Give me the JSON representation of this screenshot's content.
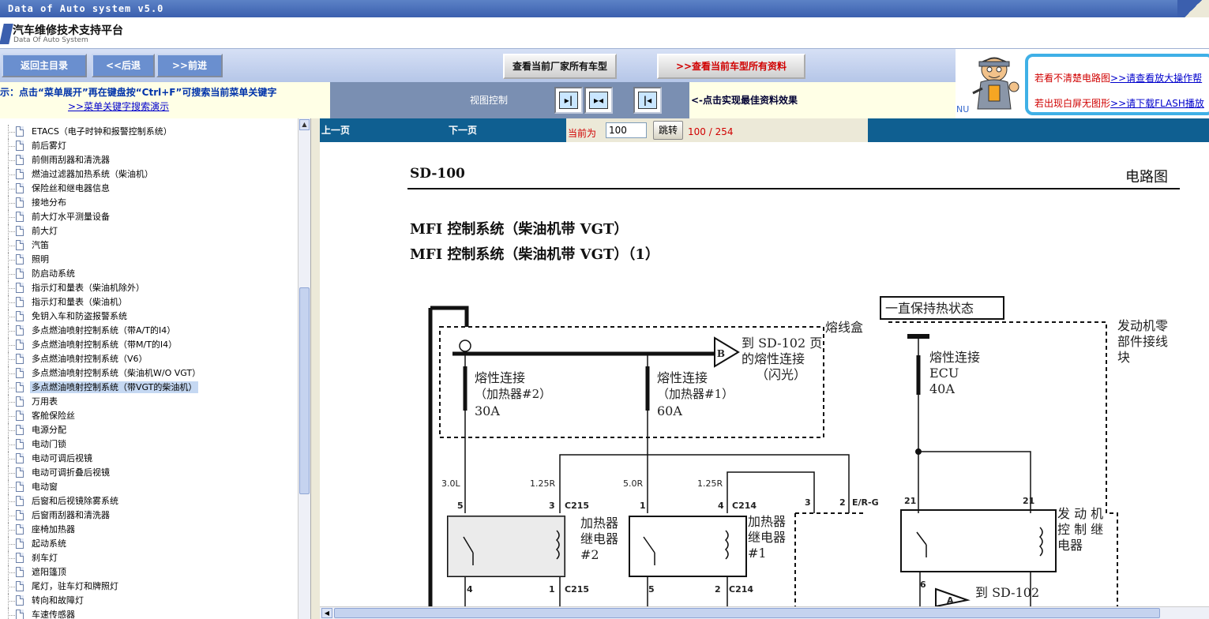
{
  "window": {
    "title": "Data of Auto system v5.0"
  },
  "header": {
    "title": "汽车维修技术支持平台",
    "subtitle": "Data Of Auto System"
  },
  "toolbar": {
    "home": "返回主目录",
    "back": "<<后退",
    "forward": ">>前进",
    "all_models": "查看当前厂家所有车型",
    "all_data": "查看当前车型所有资料",
    "all_data_arrows": ">>"
  },
  "infobar": {
    "hint": "示：点击“菜单展开”再在键盘按“Ctrl+F”可搜索当前菜单关键字",
    "hint_link": ">>菜单关键字搜索演示",
    "view_control": "视图控制",
    "best_effect": "<-点击实现最佳资料效果"
  },
  "ad": {
    "line1_prefix": "若看不清楚电路图",
    "line1_link": ">>请查看放大操作帮",
    "line2_prefix": "若出现白屏无图形",
    "line2_link": ">>请下载FLASH播放",
    "nu": "NU"
  },
  "sidebar": {
    "items": [
      {
        "label": "ETACS（电子时钟和报警控制系统）"
      },
      {
        "label": "前后雾灯"
      },
      {
        "label": "前侧雨刮器和清洗器"
      },
      {
        "label": "燃油过滤器加热系统（柴油机）"
      },
      {
        "label": "保险丝和继电器信息"
      },
      {
        "label": "接地分布"
      },
      {
        "label": "前大灯水平测量设备"
      },
      {
        "label": "前大灯"
      },
      {
        "label": "汽笛"
      },
      {
        "label": "照明"
      },
      {
        "label": "防启动系统"
      },
      {
        "label": "指示灯和量表（柴油机除外）"
      },
      {
        "label": "指示灯和量表（柴油机）"
      },
      {
        "label": "免钥入车和防盗报警系统"
      },
      {
        "label": "多点燃油喷射控制系统（带A/T的I4）"
      },
      {
        "label": "多点燃油喷射控制系统（带M/T的I4）"
      },
      {
        "label": "多点燃油喷射控制系统（V6）"
      },
      {
        "label": "多点燃油喷射控制系统（柴油机W/O VGT）"
      },
      {
        "label": "多点燃油喷射控制系统（带VGT的柴油机）"
      },
      {
        "label": "万用表"
      },
      {
        "label": "客舱保险丝"
      },
      {
        "label": "电源分配"
      },
      {
        "label": "电动门锁"
      },
      {
        "label": "电动可调后视镜"
      },
      {
        "label": "电动可调折叠后视镜"
      },
      {
        "label": "电动窗"
      },
      {
        "label": "后窗和后视镜除雾系统"
      },
      {
        "label": "后窗雨刮器和清洗器"
      },
      {
        "label": "座椅加热器"
      },
      {
        "label": "起动系统"
      },
      {
        "label": "刹车灯"
      },
      {
        "label": "遮阳篷顶"
      },
      {
        "label": "尾灯，驻车灯和牌照灯"
      },
      {
        "label": "转向和故障灯"
      },
      {
        "label": "车速传感器"
      }
    ],
    "selected_index": 18
  },
  "pager": {
    "prev": "上一页",
    "next": "下一页",
    "current_label": "当前为",
    "current_value": "100",
    "jump": "跳转",
    "count": "100 / 254"
  },
  "document": {
    "code": "SD-100",
    "type": "电路图",
    "heading1": "MFI 控制系统（柴油机带 VGT）",
    "heading2": "MFI 控制系统（柴油机带 VGT）（1）",
    "diagram": {
      "always_hot": "一直保持热状态",
      "fuse_box": "熔线盒",
      "to_sd102": "到 SD-102 页",
      "to_sd102_b": "的熔性连接",
      "to_sd102_c": "（闪光）",
      "connector_b": "B",
      "engine_junction_1": "发动机零",
      "engine_junction_2": "部件接线",
      "engine_junction_3": "块",
      "fl_heater2_1": "熔性连接",
      "fl_heater2_2": "（加热器#2）",
      "fl_heater2_3": "30A",
      "fl_heater1_1": "熔性连接",
      "fl_heater1_2": "（加热器#1）",
      "fl_heater1_3": "60A",
      "fl_ecu_1": "熔性连接",
      "fl_ecu_2": "ECU",
      "fl_ecu_3": "40A",
      "wire_30l": "3.0L",
      "wire_125r_a": "1.25R",
      "wire_50r": "5.0R",
      "wire_125r_b": "1.25R",
      "wire_erg": "E/R-G",
      "pin_5": "5",
      "pin_3": "3",
      "conn_c215_a": "C215",
      "pin_1": "1",
      "pin_4": "4",
      "conn_c214_a": "C214",
      "pin_3b": "3",
      "pin_2": "2",
      "pin_21a": "21",
      "pin_21b": "21",
      "relay2_1": "加热器",
      "relay2_2": "继电器",
      "relay2_3": "#2",
      "relay1_1": "加热器",
      "relay1_2": "继电器",
      "relay1_3": "#1",
      "ecr_1": "发 动 机",
      "ecr_2": "控 制 继",
      "ecr_3": "电器",
      "pin_4b": "4",
      "pin_1b": "1",
      "conn_c215_b": "C215",
      "pin_5b": "5",
      "pin_2b": "2",
      "conn_c214_b": "C214",
      "pin_6": "6",
      "connector_a": "A",
      "to_sd102_bottom": "到 SD-102"
    }
  }
}
